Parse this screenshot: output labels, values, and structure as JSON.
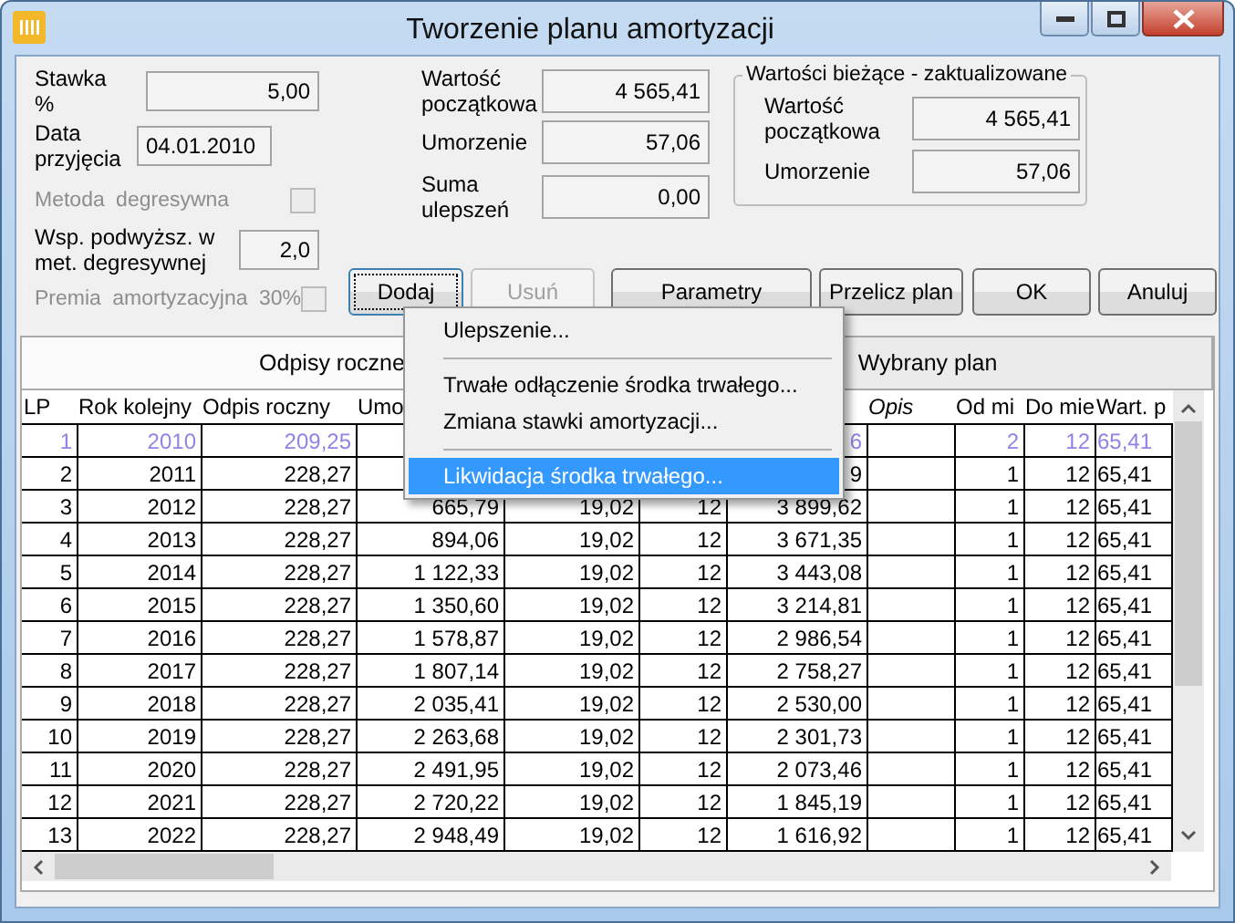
{
  "window": {
    "title": "Tworzenie planu amortyzacji"
  },
  "form": {
    "left": [
      {
        "kind": "field",
        "label": "Stawka %",
        "value": "5,00"
      },
      {
        "kind": "field",
        "label": "Data przyjęcia",
        "value": "04.01.2010"
      },
      {
        "kind": "check",
        "label": "Metoda degresywna",
        "disabled": true,
        "checked": false
      },
      {
        "kind": "field",
        "label": "Wsp. podwyższ. w met. degresywnej",
        "value": "2,0"
      },
      {
        "kind": "check",
        "label": "Premia amortyzacyjna 30%",
        "disabled": true,
        "checked": false
      }
    ],
    "middle": [
      {
        "label": "Wartość początkowa",
        "value": "4 565,41"
      },
      {
        "label": "Umorzenie",
        "value": "57,06"
      },
      {
        "label": "Suma ulepszeń",
        "value": "0,00"
      }
    ],
    "group": {
      "title": "Wartości bieżące - zaktualizowane",
      "fields": [
        {
          "label": "Wartość początkowa",
          "value": "4 565,41"
        },
        {
          "label": "Umorzenie",
          "value": "57,06"
        }
      ]
    }
  },
  "buttons": [
    {
      "label": "Dodaj",
      "disabled": false,
      "focused": true
    },
    {
      "label": "Usuń",
      "disabled": true,
      "focused": false
    },
    {
      "label": "Parametry",
      "disabled": false,
      "focused": false
    },
    {
      "label": "Przelicz plan",
      "disabled": false,
      "focused": false
    },
    {
      "label": "OK",
      "disabled": false,
      "focused": false
    },
    {
      "label": "Anuluj",
      "disabled": false,
      "focused": false
    }
  ],
  "tabs": [
    {
      "label": "Odpisy roczne",
      "selected": true
    },
    {
      "label": "Wybrany plan",
      "selected": false
    }
  ],
  "table": {
    "columns": [
      "LP",
      "Rok kolejny",
      "Odpis roczny",
      "Umo",
      null,
      null,
      null,
      "Opis",
      "Od mi",
      "Do mie",
      "Wart. p"
    ],
    "rows": [
      {
        "booked": true,
        "cells": [
          "1",
          "2010",
          "209,25",
          null,
          null,
          null,
          "6",
          null,
          "2",
          "12",
          "65,41"
        ]
      },
      {
        "booked": false,
        "cells": [
          "2",
          "2011",
          "228,27",
          null,
          null,
          null,
          "9",
          null,
          "1",
          "12",
          "65,41"
        ]
      },
      {
        "booked": false,
        "cells": [
          "3",
          "2012",
          "228,27",
          "665,79",
          "19,02",
          "12",
          "3 899,62",
          null,
          "1",
          "12",
          "65,41"
        ]
      },
      {
        "booked": false,
        "cells": [
          "4",
          "2013",
          "228,27",
          "894,06",
          "19,02",
          "12",
          "3 671,35",
          null,
          "1",
          "12",
          "65,41"
        ]
      },
      {
        "booked": false,
        "cells": [
          "5",
          "2014",
          "228,27",
          "1 122,33",
          "19,02",
          "12",
          "3 443,08",
          null,
          "1",
          "12",
          "65,41"
        ]
      },
      {
        "booked": false,
        "cells": [
          "6",
          "2015",
          "228,27",
          "1 350,60",
          "19,02",
          "12",
          "3 214,81",
          null,
          "1",
          "12",
          "65,41"
        ]
      },
      {
        "booked": false,
        "cells": [
          "7",
          "2016",
          "228,27",
          "1 578,87",
          "19,02",
          "12",
          "2 986,54",
          null,
          "1",
          "12",
          "65,41"
        ]
      },
      {
        "booked": false,
        "cells": [
          "8",
          "2017",
          "228,27",
          "1 807,14",
          "19,02",
          "12",
          "2 758,27",
          null,
          "1",
          "12",
          "65,41"
        ]
      },
      {
        "booked": false,
        "cells": [
          "9",
          "2018",
          "228,27",
          "2 035,41",
          "19,02",
          "12",
          "2 530,00",
          null,
          "1",
          "12",
          "65,41"
        ]
      },
      {
        "booked": false,
        "cells": [
          "10",
          "2019",
          "228,27",
          "2 263,68",
          "19,02",
          "12",
          "2 301,73",
          null,
          "1",
          "12",
          "65,41"
        ]
      },
      {
        "booked": false,
        "cells": [
          "11",
          "2020",
          "228,27",
          "2 491,95",
          "19,02",
          "12",
          "2 073,46",
          null,
          "1",
          "12",
          "65,41"
        ]
      },
      {
        "booked": false,
        "cells": [
          "12",
          "2021",
          "228,27",
          "2 720,22",
          "19,02",
          "12",
          "1 845,19",
          null,
          "1",
          "12",
          "65,41"
        ]
      },
      {
        "booked": false,
        "cells": [
          "13",
          "2022",
          "228,27",
          "2 948,49",
          "19,02",
          "12",
          "1 616,92",
          null,
          "1",
          "12",
          "65,41"
        ]
      }
    ]
  },
  "menu": [
    {
      "kind": "item",
      "label": "Ulepszenie...",
      "selected": false
    },
    {
      "kind": "separator"
    },
    {
      "kind": "item",
      "label": "Trwałe odłączenie środka trwałego...",
      "selected": false
    },
    {
      "kind": "item",
      "label": "Zmiana stawki amortyzacji...",
      "selected": false
    },
    {
      "kind": "separator"
    },
    {
      "kind": "item",
      "label": "Likwidacja środka trwałego...",
      "selected": true
    }
  ]
}
